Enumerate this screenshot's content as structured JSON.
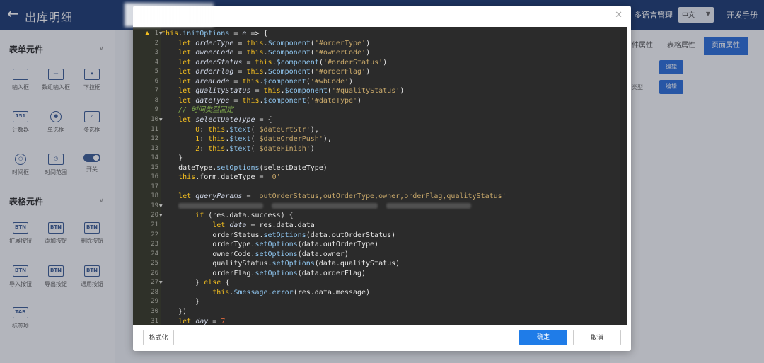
{
  "app": {
    "back_icon": "arrow-left-icon",
    "title": "出库明细",
    "lang_manage": "多语言管理",
    "lang_value": "中文",
    "dev_manual": "开发手册"
  },
  "sidebar": {
    "form_section": "表单元件",
    "form_items": [
      "输入框",
      "数组输入框",
      "下拉框",
      "计数器",
      "单选框",
      "多选框",
      "时间框",
      "时间范围",
      "开关"
    ],
    "table_section": "表格元件",
    "table_items": [
      "扩展按钮",
      "添加按钮",
      "删除按钮",
      "导入按钮",
      "导出按钮",
      "通用按钮",
      "标签项"
    ],
    "btn_icon_text": "BTN",
    "tab_icon_text": "TAB",
    "counter_icon_text": "151"
  },
  "right_panel": {
    "tabs": [
      "件属性",
      "表格属性",
      "页面属性"
    ],
    "edit_label": "编辑",
    "row_label": "类型"
  },
  "modal": {
    "close_icon": "close-icon",
    "format_label": "格式化",
    "ok_label": "确定",
    "cancel_label": "取消",
    "line_numbers": [
      "1",
      "2",
      "3",
      "4",
      "5",
      "6",
      "7",
      "8",
      "9",
      "10",
      "11",
      "12",
      "13",
      "14",
      "15",
      "16",
      "17",
      "18",
      "19",
      "20",
      "21",
      "22",
      "23",
      "24",
      "25",
      "26",
      "27",
      "28",
      "29",
      "30",
      "31"
    ],
    "folded_lines": [
      1,
      10,
      19,
      20,
      27
    ]
  }
}
